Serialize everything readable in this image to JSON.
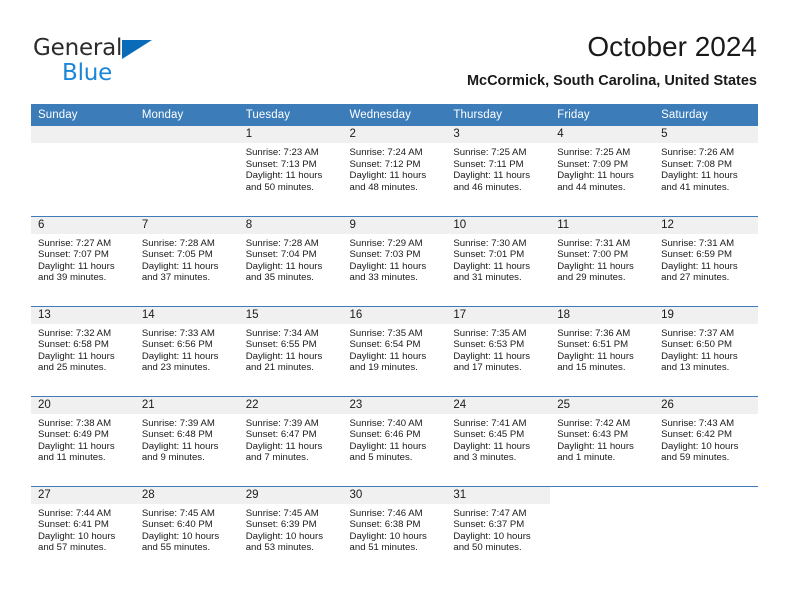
{
  "brand": {
    "name_part1": "General",
    "name_part2": "Blue",
    "triangle_icon": "triangle-logo-icon",
    "color_dark": "#2b2b2b",
    "color_blue": "#1a86d8"
  },
  "header": {
    "title": "October 2024",
    "subtitle": "McCormick, South Carolina, United States"
  },
  "theme": {
    "header_blue": "#3b7cb9",
    "daynum_band": "#f0f0f0",
    "separator": "#3b7cb9"
  },
  "weekday_headers": [
    "Sunday",
    "Monday",
    "Tuesday",
    "Wednesday",
    "Thursday",
    "Friday",
    "Saturday"
  ],
  "weeks": [
    [
      {
        "day": "",
        "sunrise": "",
        "sunset": "",
        "daylight_line1": "",
        "daylight_line2": "",
        "state": "empty"
      },
      {
        "day": "",
        "sunrise": "",
        "sunset": "",
        "daylight_line1": "",
        "daylight_line2": "",
        "state": "empty"
      },
      {
        "day": "1",
        "sunrise": "Sunrise: 7:23 AM",
        "sunset": "Sunset: 7:13 PM",
        "daylight_line1": "Daylight: 11 hours",
        "daylight_line2": "and 50 minutes.",
        "state": "filled"
      },
      {
        "day": "2",
        "sunrise": "Sunrise: 7:24 AM",
        "sunset": "Sunset: 7:12 PM",
        "daylight_line1": "Daylight: 11 hours",
        "daylight_line2": "and 48 minutes.",
        "state": "filled"
      },
      {
        "day": "3",
        "sunrise": "Sunrise: 7:25 AM",
        "sunset": "Sunset: 7:11 PM",
        "daylight_line1": "Daylight: 11 hours",
        "daylight_line2": "and 46 minutes.",
        "state": "filled"
      },
      {
        "day": "4",
        "sunrise": "Sunrise: 7:25 AM",
        "sunset": "Sunset: 7:09 PM",
        "daylight_line1": "Daylight: 11 hours",
        "daylight_line2": "and 44 minutes.",
        "state": "filled"
      },
      {
        "day": "5",
        "sunrise": "Sunrise: 7:26 AM",
        "sunset": "Sunset: 7:08 PM",
        "daylight_line1": "Daylight: 11 hours",
        "daylight_line2": "and 41 minutes.",
        "state": "filled"
      }
    ],
    [
      {
        "day": "6",
        "sunrise": "Sunrise: 7:27 AM",
        "sunset": "Sunset: 7:07 PM",
        "daylight_line1": "Daylight: 11 hours",
        "daylight_line2": "and 39 minutes.",
        "state": "filled"
      },
      {
        "day": "7",
        "sunrise": "Sunrise: 7:28 AM",
        "sunset": "Sunset: 7:05 PM",
        "daylight_line1": "Daylight: 11 hours",
        "daylight_line2": "and 37 minutes.",
        "state": "filled"
      },
      {
        "day": "8",
        "sunrise": "Sunrise: 7:28 AM",
        "sunset": "Sunset: 7:04 PM",
        "daylight_line1": "Daylight: 11 hours",
        "daylight_line2": "and 35 minutes.",
        "state": "filled"
      },
      {
        "day": "9",
        "sunrise": "Sunrise: 7:29 AM",
        "sunset": "Sunset: 7:03 PM",
        "daylight_line1": "Daylight: 11 hours",
        "daylight_line2": "and 33 minutes.",
        "state": "filled"
      },
      {
        "day": "10",
        "sunrise": "Sunrise: 7:30 AM",
        "sunset": "Sunset: 7:01 PM",
        "daylight_line1": "Daylight: 11 hours",
        "daylight_line2": "and 31 minutes.",
        "state": "filled"
      },
      {
        "day": "11",
        "sunrise": "Sunrise: 7:31 AM",
        "sunset": "Sunset: 7:00 PM",
        "daylight_line1": "Daylight: 11 hours",
        "daylight_line2": "and 29 minutes.",
        "state": "filled"
      },
      {
        "day": "12",
        "sunrise": "Sunrise: 7:31 AM",
        "sunset": "Sunset: 6:59 PM",
        "daylight_line1": "Daylight: 11 hours",
        "daylight_line2": "and 27 minutes.",
        "state": "filled"
      }
    ],
    [
      {
        "day": "13",
        "sunrise": "Sunrise: 7:32 AM",
        "sunset": "Sunset: 6:58 PM",
        "daylight_line1": "Daylight: 11 hours",
        "daylight_line2": "and 25 minutes.",
        "state": "filled"
      },
      {
        "day": "14",
        "sunrise": "Sunrise: 7:33 AM",
        "sunset": "Sunset: 6:56 PM",
        "daylight_line1": "Daylight: 11 hours",
        "daylight_line2": "and 23 minutes.",
        "state": "filled"
      },
      {
        "day": "15",
        "sunrise": "Sunrise: 7:34 AM",
        "sunset": "Sunset: 6:55 PM",
        "daylight_line1": "Daylight: 11 hours",
        "daylight_line2": "and 21 minutes.",
        "state": "filled"
      },
      {
        "day": "16",
        "sunrise": "Sunrise: 7:35 AM",
        "sunset": "Sunset: 6:54 PM",
        "daylight_line1": "Daylight: 11 hours",
        "daylight_line2": "and 19 minutes.",
        "state": "filled"
      },
      {
        "day": "17",
        "sunrise": "Sunrise: 7:35 AM",
        "sunset": "Sunset: 6:53 PM",
        "daylight_line1": "Daylight: 11 hours",
        "daylight_line2": "and 17 minutes.",
        "state": "filled"
      },
      {
        "day": "18",
        "sunrise": "Sunrise: 7:36 AM",
        "sunset": "Sunset: 6:51 PM",
        "daylight_line1": "Daylight: 11 hours",
        "daylight_line2": "and 15 minutes.",
        "state": "filled"
      },
      {
        "day": "19",
        "sunrise": "Sunrise: 7:37 AM",
        "sunset": "Sunset: 6:50 PM",
        "daylight_line1": "Daylight: 11 hours",
        "daylight_line2": "and 13 minutes.",
        "state": "filled"
      }
    ],
    [
      {
        "day": "20",
        "sunrise": "Sunrise: 7:38 AM",
        "sunset": "Sunset: 6:49 PM",
        "daylight_line1": "Daylight: 11 hours",
        "daylight_line2": "and 11 minutes.",
        "state": "filled"
      },
      {
        "day": "21",
        "sunrise": "Sunrise: 7:39 AM",
        "sunset": "Sunset: 6:48 PM",
        "daylight_line1": "Daylight: 11 hours",
        "daylight_line2": "and 9 minutes.",
        "state": "filled"
      },
      {
        "day": "22",
        "sunrise": "Sunrise: 7:39 AM",
        "sunset": "Sunset: 6:47 PM",
        "daylight_line1": "Daylight: 11 hours",
        "daylight_line2": "and 7 minutes.",
        "state": "filled"
      },
      {
        "day": "23",
        "sunrise": "Sunrise: 7:40 AM",
        "sunset": "Sunset: 6:46 PM",
        "daylight_line1": "Daylight: 11 hours",
        "daylight_line2": "and 5 minutes.",
        "state": "filled"
      },
      {
        "day": "24",
        "sunrise": "Sunrise: 7:41 AM",
        "sunset": "Sunset: 6:45 PM",
        "daylight_line1": "Daylight: 11 hours",
        "daylight_line2": "and 3 minutes.",
        "state": "filled"
      },
      {
        "day": "25",
        "sunrise": "Sunrise: 7:42 AM",
        "sunset": "Sunset: 6:43 PM",
        "daylight_line1": "Daylight: 11 hours",
        "daylight_line2": "and 1 minute.",
        "state": "filled"
      },
      {
        "day": "26",
        "sunrise": "Sunrise: 7:43 AM",
        "sunset": "Sunset: 6:42 PM",
        "daylight_line1": "Daylight: 10 hours",
        "daylight_line2": "and 59 minutes.",
        "state": "filled"
      }
    ],
    [
      {
        "day": "27",
        "sunrise": "Sunrise: 7:44 AM",
        "sunset": "Sunset: 6:41 PM",
        "daylight_line1": "Daylight: 10 hours",
        "daylight_line2": "and 57 minutes.",
        "state": "filled"
      },
      {
        "day": "28",
        "sunrise": "Sunrise: 7:45 AM",
        "sunset": "Sunset: 6:40 PM",
        "daylight_line1": "Daylight: 10 hours",
        "daylight_line2": "and 55 minutes.",
        "state": "filled"
      },
      {
        "day": "29",
        "sunrise": "Sunrise: 7:45 AM",
        "sunset": "Sunset: 6:39 PM",
        "daylight_line1": "Daylight: 10 hours",
        "daylight_line2": "and 53 minutes.",
        "state": "filled"
      },
      {
        "day": "30",
        "sunrise": "Sunrise: 7:46 AM",
        "sunset": "Sunset: 6:38 PM",
        "daylight_line1": "Daylight: 10 hours",
        "daylight_line2": "and 51 minutes.",
        "state": "filled"
      },
      {
        "day": "31",
        "sunrise": "Sunrise: 7:47 AM",
        "sunset": "Sunset: 6:37 PM",
        "daylight_line1": "Daylight: 10 hours",
        "daylight_line2": "and 50 minutes.",
        "state": "filled"
      },
      {
        "day": "",
        "sunrise": "",
        "sunset": "",
        "daylight_line1": "",
        "daylight_line2": "",
        "state": "blank"
      },
      {
        "day": "",
        "sunrise": "",
        "sunset": "",
        "daylight_line1": "",
        "daylight_line2": "",
        "state": "blank"
      }
    ]
  ]
}
